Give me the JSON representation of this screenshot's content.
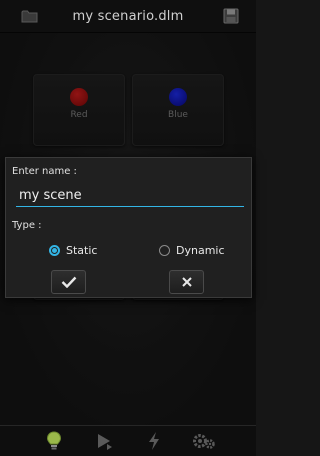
{
  "header": {
    "title": "my scenario.dlm",
    "left_icon": "folder-icon",
    "right_icon": "save-icon"
  },
  "tiles": [
    {
      "label": "Red",
      "color": "#b01010"
    },
    {
      "label": "Blue",
      "color": "#0a14c8"
    }
  ],
  "dialog": {
    "name_heading": "Enter name :",
    "name_value": "my scene",
    "type_heading": "Type :",
    "options": [
      {
        "label": "Static",
        "selected": true
      },
      {
        "label": "Dynamic",
        "selected": false
      }
    ],
    "confirm_icon": "checkmark-icon",
    "cancel_icon": "close-icon"
  },
  "bottom_nav": {
    "items": [
      {
        "icon": "lightbulb-icon",
        "active": true
      },
      {
        "icon": "play-icon",
        "active": false
      },
      {
        "icon": "lightning-icon",
        "active": false
      },
      {
        "icon": "gears-icon",
        "active": false
      }
    ]
  },
  "colors": {
    "accent": "#33b5e5",
    "active_bulb": "#9ab84a"
  }
}
